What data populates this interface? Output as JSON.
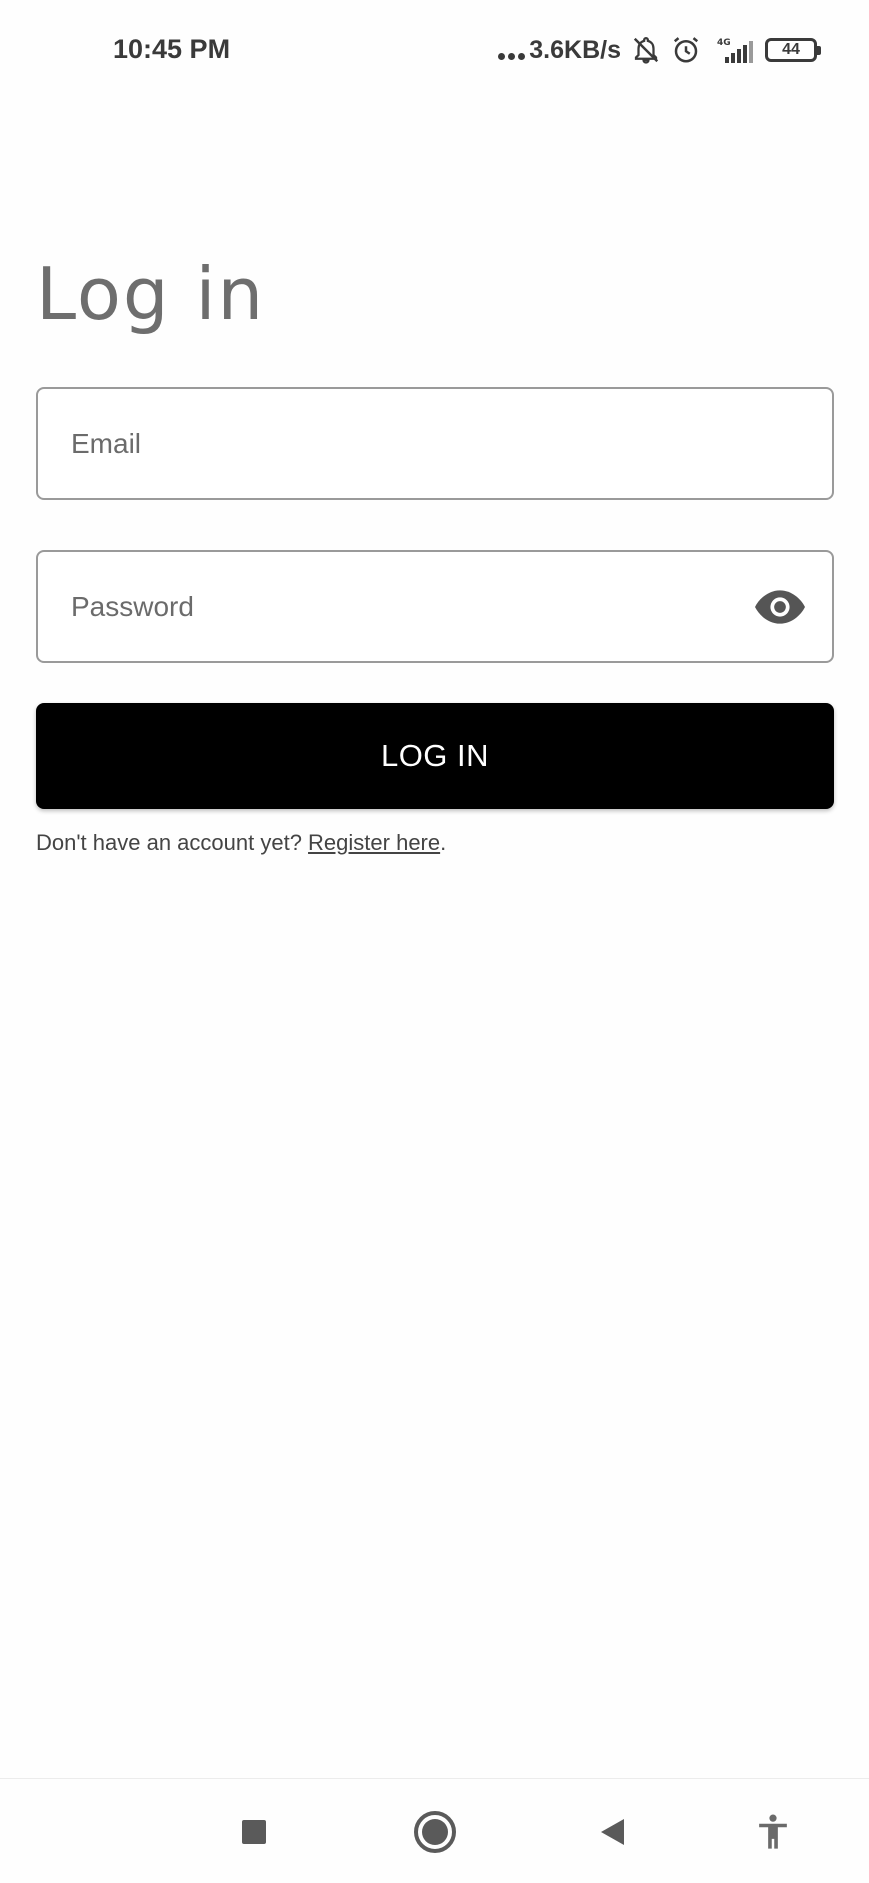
{
  "status_bar": {
    "time": "10:45 PM",
    "net_speed": "3.6KB/s",
    "battery_level": "44",
    "icons": [
      "notifications-off-icon",
      "alarm-icon",
      "signal-4g-icon",
      "battery-icon"
    ]
  },
  "page": {
    "title": "Log in"
  },
  "form": {
    "email_placeholder": "Email",
    "password_placeholder": "Password",
    "login_label": "LOG IN"
  },
  "register": {
    "prompt": "Don't have an account yet? ",
    "link_label": "Register here",
    "suffix": "."
  },
  "nav": {
    "icons": [
      "recents-icon",
      "home-icon",
      "back-icon",
      "accessibility-icon"
    ]
  },
  "colors": {
    "button_bg": "#000000",
    "button_text": "#ffffff",
    "title": "#6e6e6e",
    "field_border": "#9a9a9a"
  }
}
